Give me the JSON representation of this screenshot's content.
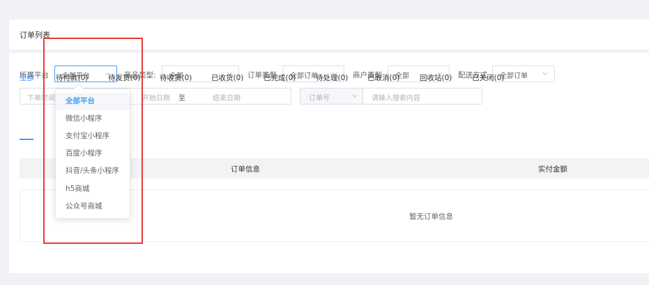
{
  "header": {
    "title": "订单列表"
  },
  "filters": {
    "platform": {
      "label": "所属平台",
      "value": "全部平台"
    },
    "product_type": {
      "label": "商品类型:",
      "value": "全部"
    },
    "order_type": {
      "label": "订单类型",
      "value": "全部订单"
    },
    "merchant_type": {
      "label": "商户类型",
      "value": "全部"
    },
    "delivery": {
      "label": "配送方式",
      "value": "全部订单"
    },
    "date": {
      "label": "下单时间",
      "start_placeholder": "开始日期",
      "separator": "至",
      "end_placeholder": "结束日期"
    },
    "search": {
      "field": "订单号",
      "placeholder": "请输入搜索内容"
    }
  },
  "tabs": [
    {
      "label": "全部"
    },
    {
      "label": "待付款(0)"
    },
    {
      "label": "待发货(0)"
    },
    {
      "label": "待收货(0)"
    },
    {
      "label": "已收货(0)"
    },
    {
      "label": "已完成(0)"
    },
    {
      "label": "待处理(0)"
    },
    {
      "label": "已取消(0)"
    },
    {
      "label": "回收站(0)"
    },
    {
      "label": "已关闭(0)"
    }
  ],
  "table": {
    "columns": [
      "订单信息",
      "实付金额"
    ],
    "empty_text": "暂无订单信息"
  },
  "dropdown": {
    "options": [
      "全部平台",
      "微信小程序",
      "支付宝小程序",
      "百度小程序",
      "抖音/头条小程序",
      "h5商城",
      "公众号商城"
    ],
    "selected": "全部平台"
  },
  "colors": {
    "accent": "#409eff",
    "highlight": "#e53935"
  }
}
